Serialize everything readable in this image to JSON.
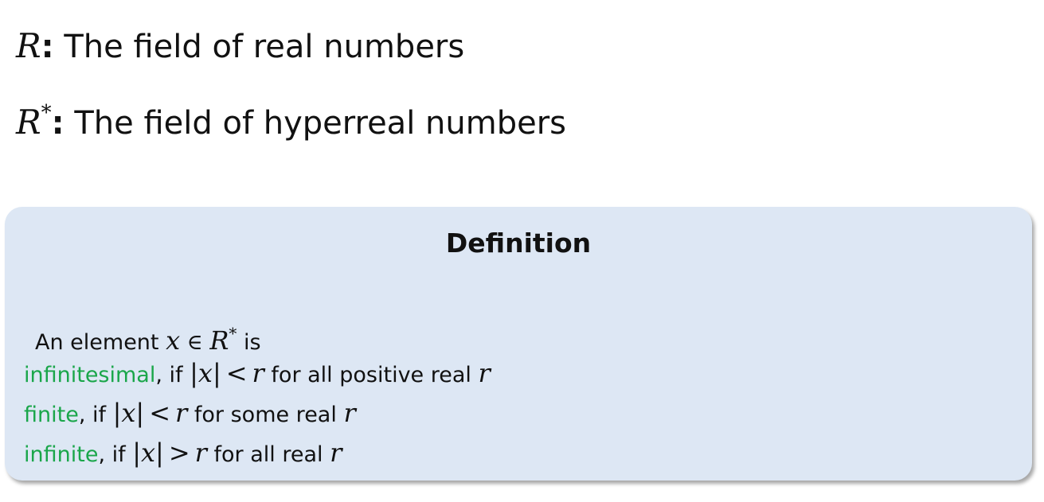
{
  "header": {
    "line1": {
      "symbol": "R",
      "colon": ":",
      "text": " The field of real numbers"
    },
    "line2": {
      "symbol": "R",
      "superscript": "*",
      "colon": ":",
      "text": " The field of hyperreal numbers"
    }
  },
  "definition": {
    "title": "Definition",
    "intro": {
      "prefix": "An element ",
      "var": "x",
      "in": "∈",
      "set": "R",
      "superscript": "*",
      "suffix": " is"
    },
    "conditions": [
      {
        "term": "infinitesimal",
        "sep": ", if ",
        "abs_open": "|",
        "var": "x",
        "abs_close": "|",
        "rel": "<",
        "rhs": "r",
        "tail": " for all positive real ",
        "tail_var": "r"
      },
      {
        "term": "finite",
        "sep": ", if ",
        "abs_open": "|",
        "var": "x",
        "abs_close": "|",
        "rel": "<",
        "rhs": "r",
        "tail": " for some real ",
        "tail_var": "r"
      },
      {
        "term": "infinite",
        "sep": ", if ",
        "abs_open": "|",
        "var": "x",
        "abs_close": "|",
        "rel": ">",
        "rhs": "r",
        "tail": " for all real ",
        "tail_var": "r"
      }
    ]
  },
  "colors": {
    "term": "#1aa64a",
    "box_background": "#dde7f4"
  }
}
